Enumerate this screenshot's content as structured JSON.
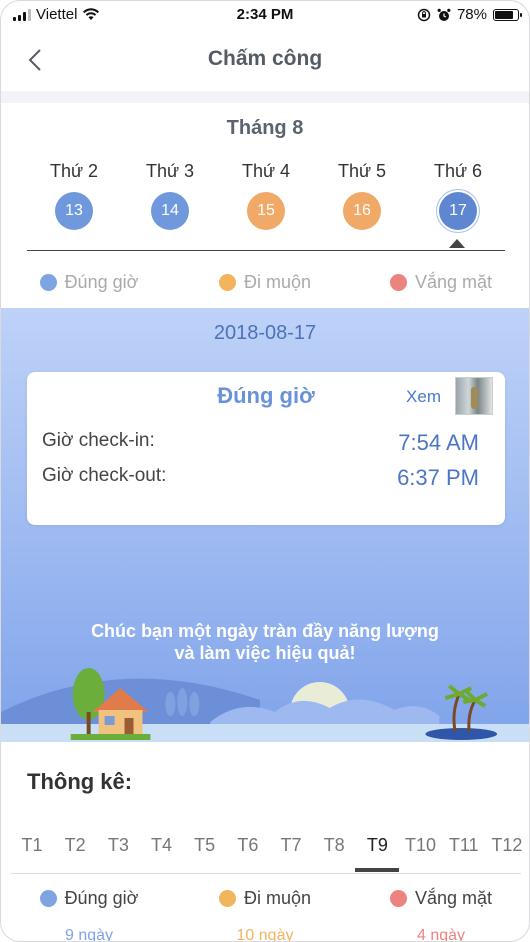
{
  "status_bar": {
    "carrier": "Viettel",
    "time": "2:34 PM",
    "battery": "78%"
  },
  "nav": {
    "title": "Chấm công"
  },
  "calendar": {
    "month": "Tháng 8",
    "days": [
      {
        "name": "Thứ 2",
        "num": "13",
        "status": "on_time"
      },
      {
        "name": "Thứ 3",
        "num": "14",
        "status": "on_time"
      },
      {
        "name": "Thứ 4",
        "num": "15",
        "status": "late"
      },
      {
        "name": "Thứ 5",
        "num": "16",
        "status": "late"
      },
      {
        "name": "Thứ 6",
        "num": "17",
        "status": "on_time",
        "selected": true
      }
    ]
  },
  "legend": {
    "on_time": "Đúng giờ",
    "late": "Đi muộn",
    "absent": "Vắng mặt"
  },
  "detail": {
    "date": "2018-08-17",
    "status": "Đúng giờ",
    "view_label": "Xem",
    "checkin_label": "Giờ check-in:",
    "checkin_value": "7:54 AM",
    "checkout_label": "Giờ check-out:",
    "checkout_value": "6:37 PM",
    "slogan_line1": "Chúc bạn một ngày tràn đầy năng lượng",
    "slogan_line2": "và làm việc hiệu quả!"
  },
  "stats": {
    "title": "Thông kê:",
    "months": [
      "T1",
      "T2",
      "T3",
      "T4",
      "T5",
      "T6",
      "T7",
      "T8",
      "T9",
      "T10",
      "T11",
      "T12"
    ],
    "active_month": "T9",
    "on_time_count": "9 ngày",
    "late_count": "10 ngày",
    "absent_count": "4 ngày"
  },
  "colors": {
    "on_time": "#7fa4e2",
    "late": "#f2b45c",
    "absent": "#ec837f",
    "accent": "#4a76c4"
  }
}
